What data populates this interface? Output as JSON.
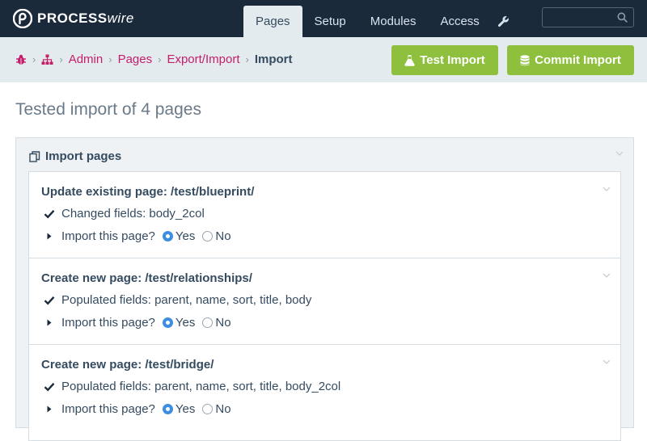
{
  "brand": {
    "logo_bold": "PROCESS",
    "logo_italic": "wire"
  },
  "nav": {
    "items": [
      "Pages",
      "Setup",
      "Modules",
      "Access"
    ]
  },
  "search": {
    "value": ""
  },
  "breadcrumb": {
    "items": [
      "Admin",
      "Pages",
      "Export/Import"
    ],
    "current": "Import"
  },
  "actions": {
    "test_label": "Test Import",
    "commit_label": "Commit Import"
  },
  "page_title": "Tested import of 4 pages",
  "section": {
    "title": "Import pages"
  },
  "entries": [
    {
      "title": "Update existing page: /test/blueprint/",
      "fields": "Changed fields: body_2col",
      "question": "Import this page?",
      "yes": "Yes",
      "no": "No",
      "selected": "Yes"
    },
    {
      "title": "Create new page: /test/relationships/",
      "fields": "Populated fields: parent, name, sort, title, body",
      "question": "Import this page?",
      "yes": "Yes",
      "no": "No",
      "selected": "Yes"
    },
    {
      "title": "Create new page: /test/bridge/",
      "fields": "Populated fields: parent, name, sort, title, body_2col",
      "question": "Import this page?",
      "yes": "Yes",
      "no": "No",
      "selected": "Yes"
    }
  ],
  "colors": {
    "topbar": "#1a2a3b",
    "header": "#e4ebee",
    "accent_button": "#8ec03e",
    "link": "#c41e6a",
    "radio": "#3d8ee0"
  },
  "icons": [
    "processwire-logo-icon",
    "wrench-icon",
    "search-icon",
    "bug-icon",
    "sitemap-icon",
    "flask-icon",
    "database-icon",
    "copy-icon",
    "chevron-down-icon",
    "check-icon",
    "caret-right-icon"
  ]
}
